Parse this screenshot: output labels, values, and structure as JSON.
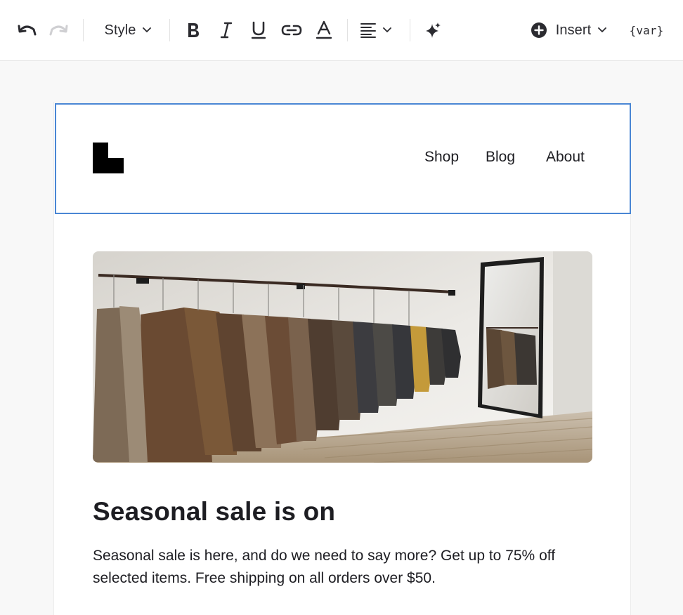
{
  "toolbar": {
    "undo_icon": "undo-icon",
    "redo_icon": "redo-icon",
    "style_label": "Style",
    "bold_icon": "bold-icon",
    "italic_icon": "italic-icon",
    "underline_icon": "underline-icon",
    "link_icon": "link-icon",
    "text_color_icon": "text-color-icon",
    "align_icon": "align-left-icon",
    "ai_icon": "sparkle-icon",
    "insert_label": "Insert",
    "variable_label": "{var}"
  },
  "email": {
    "logo": "brand-logo",
    "nav": [
      "Shop",
      "Blog",
      "About"
    ],
    "hero_image": "clothing-rack-photo",
    "headline": "Seasonal sale is on",
    "body": "Seasonal sale is here, and do we need to say more? Get up to 75% off selected items. Free shipping on all orders over $50."
  },
  "colors": {
    "selection_outline": "#4a86d4",
    "canvas_background": "#f8f8f8",
    "text": "#1d1d22"
  }
}
